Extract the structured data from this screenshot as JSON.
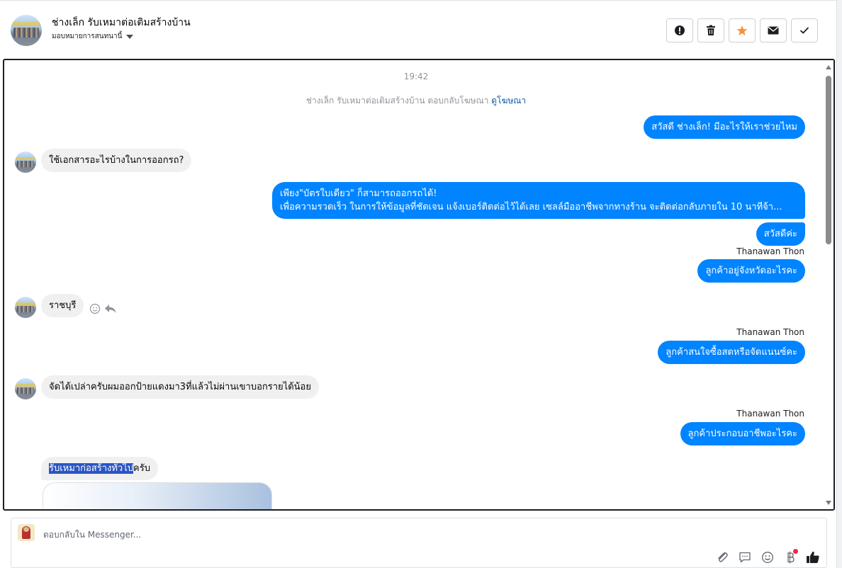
{
  "header": {
    "title": "ช่างเล็ก รับเหมาต่อเติมสร้างบ้าน",
    "assign_label": "มอบหมายการสนทนานี้",
    "actions": [
      "spam-icon",
      "trash-icon",
      "star-icon",
      "mail-icon",
      "check-icon"
    ]
  },
  "chat": {
    "timestamp": "19:42",
    "reply_context": "ช่างเล็ก รับเหมาต่อเติมสร้างบ้าน ตอบกลับโฆษณา",
    "reply_context_link": "ดูโฆษณา",
    "messages": {
      "m1": "สวัสดี ช่างเล็ก! มีอะไรให้เราช่วยไหม",
      "m2": "ใช้เอกสารอะไรบ้างในการออกรถ?",
      "m3_line1": "เพียง\"บัตรใบเดียว\" ก็สามารถออกรถได้!",
      "m3_line2": "เพื่อความรวดเร็ว ในการให้ข้อมูลที่ชัดเจน แจ้งเบอร์ติดต่อไว้ได้เลย เซลล์มืออาชีพจากทางร้าน จะติดต่อกลับภายใน 10 นาทีจ้า...",
      "m4": "สวัสดีค่ะ",
      "m5": "ลูกค้าอยู่จังหวัดอะไรคะ",
      "m6": "ราชบุรี",
      "m7": "ลูกค้าสนใจซื้อสดหรือจัดแนนซ์คะ",
      "m8": "จัดได้เปล่าครับผมออกป้ายแดงมา3ที่แล้วไม่ผ่านเขาบอกรายได้น้อย",
      "m9": "ลูกค้าประกอบอาชีพอะไรคะ",
      "m10_selected": "รับเหมาก่อสร้างทั่วไป",
      "m10_rest": "ครับ"
    },
    "sender_name": "Thanawan Thon"
  },
  "composer": {
    "placeholder": "ตอบกลับใน Messenger...",
    "tools": [
      "attach-icon",
      "saved-replies-icon",
      "emoji-icon",
      "payment-icon",
      "like-icon"
    ]
  },
  "colors": {
    "outgoing": "#0084ff",
    "incoming": "#f0f0f0",
    "star": "#f7923a",
    "link": "#0a5aa8"
  }
}
